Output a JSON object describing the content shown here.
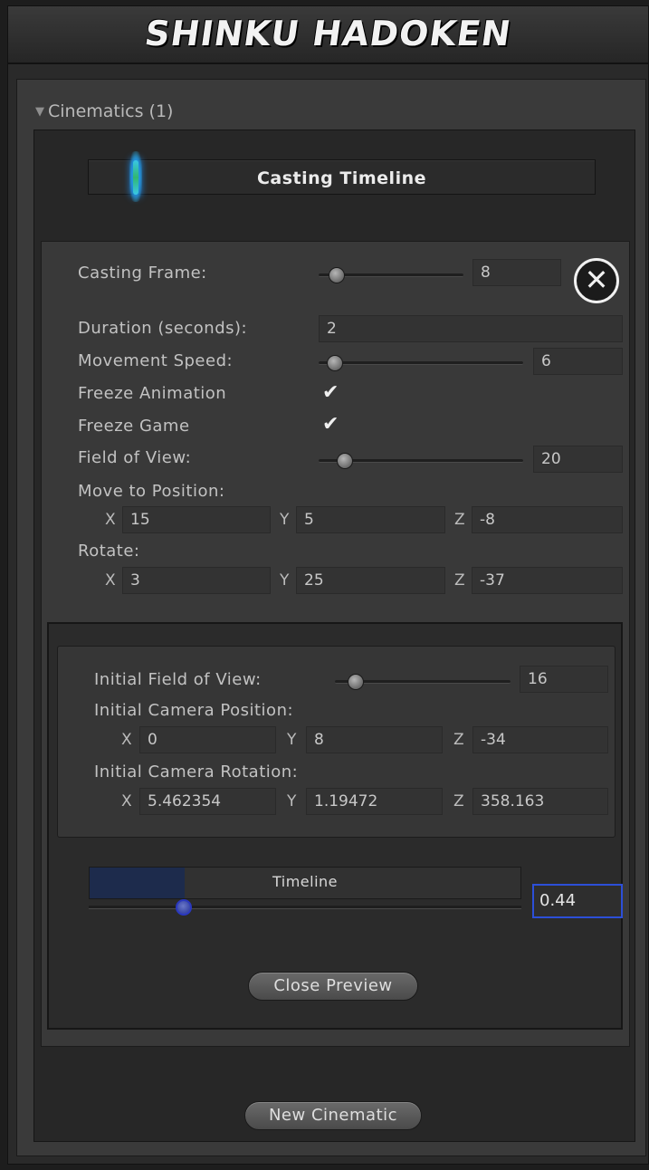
{
  "window": {
    "title": "SHINKU HADOKEN"
  },
  "cinematics": {
    "foldout_label": "Cinematics (1)",
    "header_title": "Casting Timeline",
    "casting_frame": {
      "label": "Casting Frame:",
      "value": "8"
    },
    "duration": {
      "label": "Duration (seconds):",
      "value": "2"
    },
    "movement_speed": {
      "label": "Movement Speed:",
      "value": "6"
    },
    "freeze_animation": {
      "label": "Freeze Animation",
      "checked": true
    },
    "freeze_game": {
      "label": "Freeze Game",
      "checked": true
    },
    "field_of_view": {
      "label": "Field of View:",
      "value": "20"
    },
    "move_to_position": {
      "label": "Move to Position:",
      "x": "15",
      "y": "5",
      "z": "-8"
    },
    "rotate": {
      "label": "Rotate:",
      "x": "3",
      "y": "25",
      "z": "-37"
    },
    "axis_labels": {
      "x": "X",
      "y": "Y",
      "z": "Z"
    },
    "check_glyph": "✔",
    "close_glyph": "✕",
    "preview": {
      "initial_fov": {
        "label": "Initial Field of View:",
        "value": "16"
      },
      "initial_position": {
        "label": "Initial Camera Position:",
        "x": "0",
        "y": "8",
        "z": "-34"
      },
      "initial_rotation": {
        "label": "Initial Camera Rotation:",
        "x": "5.462354",
        "y": "1.19472",
        "z": "358.163"
      },
      "timeline": {
        "label": "Timeline",
        "value": "0.44",
        "progress": 0.22
      },
      "close_preview_label": "Close Preview"
    },
    "new_cinematic_label": "New Cinematic"
  },
  "colors": {
    "accent": "#2c4fd8",
    "timeline_fill": "#1d2b4c",
    "glow": "#31b870"
  }
}
